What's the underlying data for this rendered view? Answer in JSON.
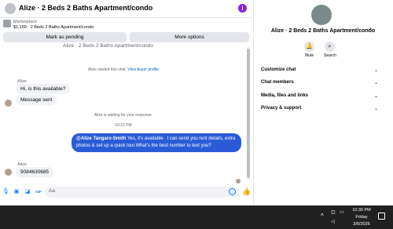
{
  "header": {
    "title": "Alize · 2 Beds 2 Baths Apartment/condo",
    "chevron_icon": "chevron-down-icon",
    "menu_icon": "more-icon",
    "menu_glyph": "i"
  },
  "listing": {
    "label": "Marketplace",
    "info": "$1,150 · 2 Beds 2 Baths Apartment/condo"
  },
  "actions": {
    "mark_pending": "Mark as pending",
    "more_options": "More options"
  },
  "conversation": {
    "cut_title": "Alize · 2 Beds 2 Baths Apartment/condo",
    "started_text": "Alize started this chat.",
    "started_link": "View buyer profile",
    "messages_group1_sender": "Alize",
    "msg1": "Hi, is this available?",
    "msg2": "Message sent",
    "waiting": "Alize is waiting for your response.",
    "timestamp": "10:15 PM",
    "outgoing_mention": "@Alize Tangaro-Smith",
    "outgoing_text": " Yes, it's available .  I can send you rent details, extra photos & set up a quick tour.What's the best number to text you?",
    "messages_group2_sender": "Alize",
    "msg3": "9084630685"
  },
  "composer": {
    "placeholder": "Aa",
    "gif": "GIF"
  },
  "info_pane": {
    "title": "Alize · 2 Beds 2 Baths Apartment/condo",
    "mute": "Mute",
    "search": "Search",
    "sections": [
      "Customize chat",
      "Chat members",
      "Media, files and links",
      "Privacy & support"
    ]
  },
  "taskbar": {
    "time": "10:30 PM",
    "day": "Friday",
    "date": "3/6/2026"
  },
  "colors": {
    "accent": "#0a7cff",
    "outgoing_bubble": "#2a5bd7",
    "menu_badge": "#8a1ce0",
    "taskbar": "#202020"
  }
}
